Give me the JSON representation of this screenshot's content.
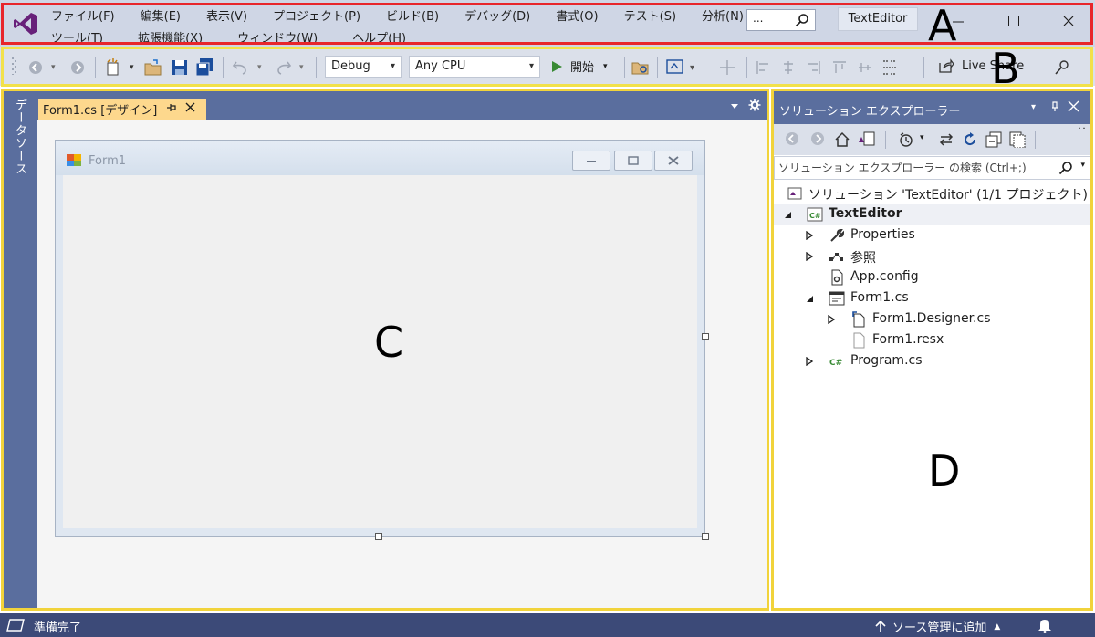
{
  "menu": {
    "row1": [
      "ファイル(F)",
      "編集(E)",
      "表示(V)",
      "プロジェクト(P)",
      "ビルド(B)",
      "デバッグ(D)",
      "書式(O)",
      "テスト(S)",
      "分析(N)"
    ],
    "row2": [
      "ツール(T)",
      "拡張機能(X)",
      "ウィンドウ(W)",
      "ヘルプ(H)"
    ]
  },
  "search": {
    "label": "..."
  },
  "solution_name": "TextEditor",
  "toolbar": {
    "config": "Debug",
    "platform": "Any CPU",
    "start_label": "開始",
    "liveshare_label": "Live Share"
  },
  "annotations": {
    "a": "A",
    "b": "B",
    "c": "C",
    "d": "D"
  },
  "annotation_colors": {
    "a": "#e8262b",
    "b": "#f2e14a",
    "c": "#f1d33b",
    "d": "#f1d33b"
  },
  "datasource_label": "データソース",
  "document": {
    "tab_label": "Form1.cs [デザイン]",
    "form_title": "Form1"
  },
  "solution_explorer": {
    "title": "ソリューション エクスプローラー",
    "search_placeholder": "ソリューション エクスプローラー の検索 (Ctrl+;)",
    "tree": [
      {
        "label": "ソリューション 'TextEditor' (1/1 プロジェクト)",
        "icon": "solution-icon",
        "expander": "none"
      },
      {
        "label": "TextEditor",
        "icon": "csharp-project-icon",
        "expander": "expanded"
      },
      {
        "label": "Properties",
        "icon": "wrench-icon",
        "expander": "collapsed"
      },
      {
        "label": "参照",
        "icon": "references-icon",
        "expander": "collapsed"
      },
      {
        "label": "App.config",
        "icon": "config-file-icon",
        "expander": "none"
      },
      {
        "label": "Form1.cs",
        "icon": "form-icon",
        "expander": "expanded"
      },
      {
        "label": "Form1.Designer.cs",
        "icon": "designer-file-icon",
        "expander": "collapsed"
      },
      {
        "label": "Form1.resx",
        "icon": "resx-file-icon",
        "expander": "none"
      },
      {
        "label": "Program.cs",
        "icon": "csharp-file-icon",
        "expander": "collapsed"
      }
    ]
  },
  "status": {
    "text": "準備完了",
    "scm_label": "ソース管理に追加"
  },
  "colors": {
    "accent": "#68217a",
    "panel_header": "#5a6e9e",
    "tab_active": "#fdd88d",
    "statusbar": "#3c4a78"
  }
}
